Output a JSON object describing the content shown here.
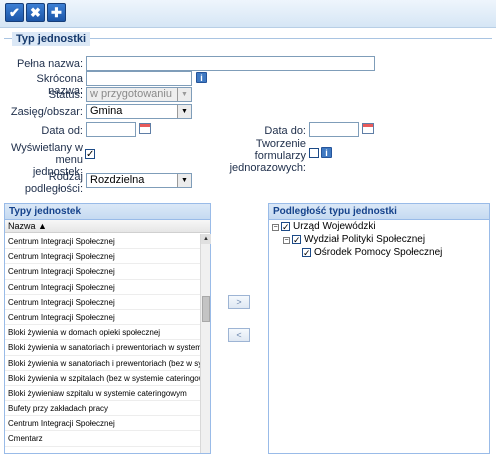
{
  "toolbar": {
    "save_icon": "check-icon",
    "cancel_icon": "x-icon",
    "add_icon": "plus-icon",
    "save_glyph": "✔",
    "cancel_glyph": "✖",
    "add_glyph": "✚"
  },
  "form": {
    "legend": "Typ jednostki",
    "full_name_label": "Pełna nazwa:",
    "full_name_value": "",
    "short_name_label": "Skrócona nazwa:",
    "short_name_value": "",
    "status_label": "Status:",
    "status_value": "w przygotowaniu",
    "scope_label": "Zasięg/obszar:",
    "scope_value": "Gmina",
    "date_from_label": "Data od:",
    "date_from_value": "",
    "date_to_label": "Data do:",
    "date_to_value": "",
    "show_in_menu_label_1": "Wyświetlany w",
    "show_in_menu_label_2": "menu jednostek:",
    "show_in_menu_checked": "✓",
    "forms_label_1": "Tworzenie",
    "forms_label_2": "formularzy",
    "forms_label_3": "jednorazowych:",
    "forms_checked": "",
    "subordination_label_1": "Rodzaj",
    "subordination_label_2": "podległości:",
    "subordination_value": "Rozdzielna",
    "info_glyph": "i"
  },
  "unit_types": {
    "title": "Typy jednostek",
    "column_header": "Nazwa ▲",
    "rows": [
      "Centrum Integracji Społecznej",
      "Centrum Integracji Społecznej",
      "Centrum Integracji Społecznej",
      "Centrum Integracji Społecznej",
      "Centrum Integracji Społecznej",
      "Centrum Integracji Społecznej",
      "Bloki żywienia w domach opieki społecznej",
      "Bloki żywienia w sanatoriach i prewentoriach w systemie",
      "Bloki żywienia w sanatoriach i prewentoriach (bez w sy",
      "Bloki żywienia w szpitalach (bez w systemie cateringow",
      "Bloki żywieniaw szpitalu w systemie cateringowym",
      "Bufety przy zakładach pracy",
      "Centrum Integracji Społecznej",
      "Cmentarz"
    ]
  },
  "move_buttons": {
    "right": ">",
    "left": "<"
  },
  "subordination": {
    "title": "Podległość typu jednostki",
    "tree": [
      {
        "label": "Urząd Wojewódzki",
        "toggle": "−",
        "checked": "✓"
      },
      {
        "label": "Wydział Polityki Społecznej",
        "toggle": "−",
        "checked": "✓"
      },
      {
        "label": "Ośrodek Pomocy Społecznej",
        "toggle": "",
        "checked": "✓"
      }
    ]
  }
}
